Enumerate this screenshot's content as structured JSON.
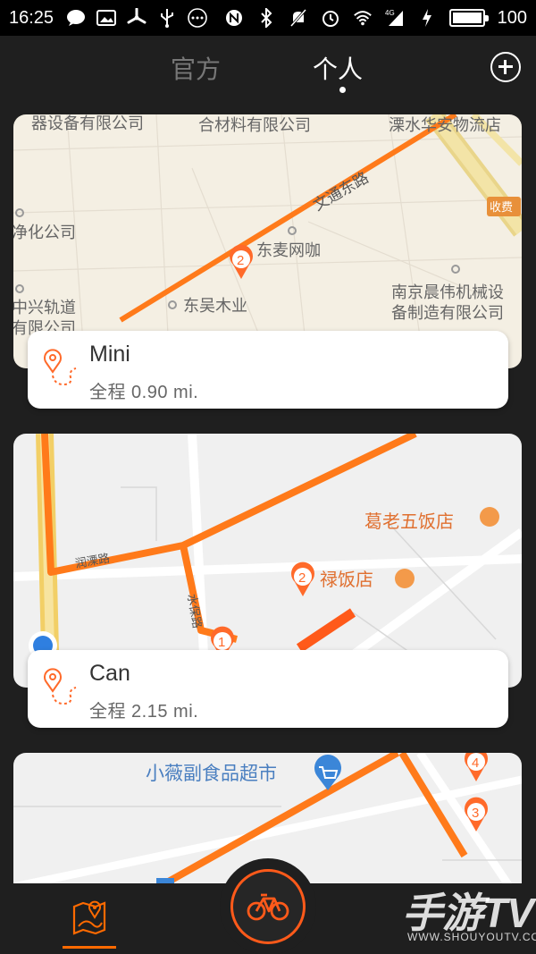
{
  "status_bar": {
    "time": "16:25",
    "battery": "100",
    "battery_level": 1.0,
    "left_icons": [
      "chat-bubble-icon",
      "image-icon",
      "fan-icon",
      "usb-icon",
      "more-dots-icon"
    ],
    "right_icons": [
      "nfc-icon",
      "bluetooth-icon",
      "mute-icon",
      "alarm-icon",
      "wifi-icon",
      "4g-signal-icon",
      "charging-icon",
      "battery-icon"
    ]
  },
  "header": {
    "tabs": [
      {
        "label": "官方",
        "active": false
      },
      {
        "label": "个人",
        "active": true
      }
    ],
    "add_icon": "add-circle-icon"
  },
  "routes": [
    {
      "name": "Mini",
      "distance": "全程 0.90 mi.",
      "map_labels": {
        "l1": "器设备有限公司",
        "l2": "合材料有限公司",
        "l3": "溧水华安物流店",
        "l4": "净化公司",
        "l5": "文通东路",
        "l6": "收费",
        "l7": "东麦网咖",
        "l8": "中兴轨道",
        "l9": "有限公司",
        "l10": "东吴木业",
        "l11": "南京晨伟机械设",
        "l12": "备制造有限公司",
        "l13": "东路",
        "pin": "2"
      }
    },
    {
      "name": "Can",
      "distance": "全程 2.15 mi.",
      "map_labels": {
        "l1": "葛老五饭店",
        "l2": "禄饭店",
        "l3": "润溧路",
        "l4": "水保路",
        "pin1": "2",
        "pin2": "1"
      }
    },
    {
      "map_labels": {
        "l1": "小薇副食品超市",
        "pin1": "4",
        "pin2": "3"
      }
    }
  ],
  "bottom_nav": {
    "map_icon": "route-map-icon",
    "ride_icon": "bicycle-icon"
  },
  "watermark": {
    "big": "手游TV",
    "small": "WWW.SHOUYOUTV.COM"
  },
  "colors": {
    "accent": "#ff6a00",
    "route": "#ff7a1a",
    "background": "#1f1f1f"
  }
}
